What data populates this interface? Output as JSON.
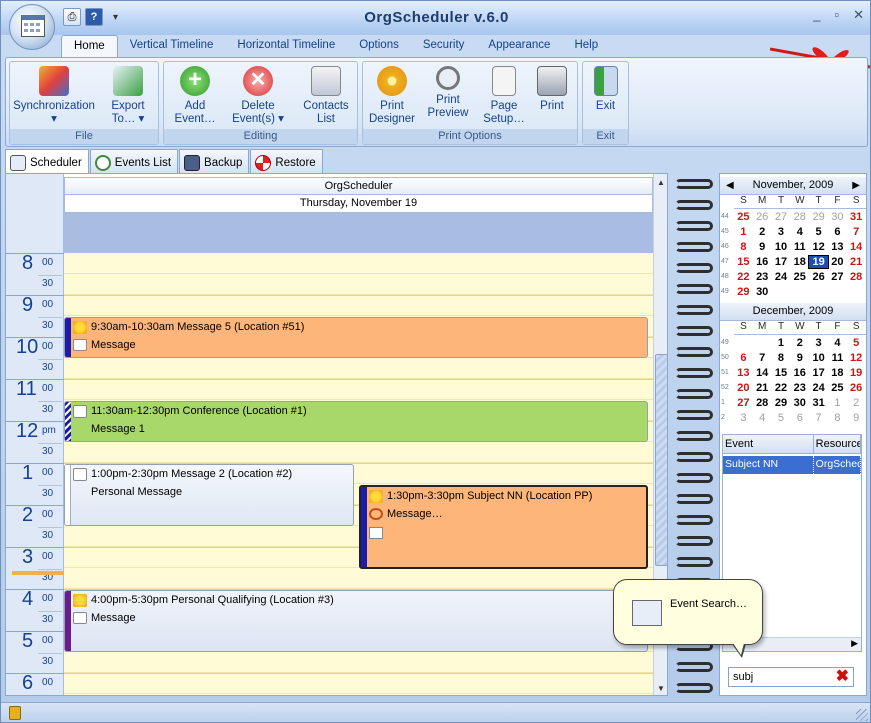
{
  "app": {
    "title": "OrgScheduler v.6.0"
  },
  "window_controls": {
    "minimize": "_",
    "maximize": "▫",
    "close": "✕"
  },
  "qat": {
    "more": "▾"
  },
  "ribbon_tabs": [
    "Home",
    "Vertical Timeline",
    "Horizontal Timeline",
    "Options",
    "Security",
    "Appearance",
    "Help"
  ],
  "ribbon": {
    "file": {
      "label": "File",
      "sync": "Synchronization",
      "sync2": "▾",
      "export": "Export",
      "export2": "To… ▾"
    },
    "editing": {
      "label": "Editing",
      "add": "Add",
      "add2": "Event…",
      "delete": "Delete",
      "delete2": "Event(s) ▾",
      "contacts": "Contacts",
      "contacts2": "List"
    },
    "print": {
      "label": "Print Options",
      "designer": "Print",
      "designer2": "Designer",
      "preview": "Print",
      "preview2": "Preview",
      "setup": "Page",
      "setup2": "Setup…",
      "print": "Print"
    },
    "exit": {
      "label": "Exit",
      "exit": "Exit"
    }
  },
  "view_tabs": [
    "Scheduler",
    "Events List",
    "Backup",
    "Restore"
  ],
  "scheduler": {
    "resource": "OrgScheduler",
    "date": "Thursday, November 19",
    "hours": [
      {
        "h": "8",
        "m": "00"
      },
      {
        "h": "9",
        "m": "00"
      },
      {
        "h": "10",
        "m": "00"
      },
      {
        "h": "11",
        "m": "00"
      },
      {
        "h": "12",
        "m": "pm"
      },
      {
        "h": "1",
        "m": "00"
      },
      {
        "h": "2",
        "m": "00"
      },
      {
        "h": "3",
        "m": "00"
      },
      {
        "h": "4",
        "m": "00"
      },
      {
        "h": "5",
        "m": "00"
      },
      {
        "h": "6",
        "m": "00"
      }
    ],
    "half": "30",
    "events": [
      {
        "title": "9:30am-10:30am Message 5 (Location #51)",
        "body": "Message"
      },
      {
        "title": "11:30am-12:30pm Conference (Location #1)",
        "body": "Message 1"
      },
      {
        "title": "1:00pm-2:30pm Message 2 (Location #2)",
        "body": "Personal Message"
      },
      {
        "title": "1:30pm-3:30pm Subject NN (Location PP)",
        "body": "Message…"
      },
      {
        "title": "4:00pm-5:30pm Personal Qualifying (Location #3)",
        "body": "Message"
      }
    ],
    "colors": {
      "orange": "#fdb57a",
      "green": "#a8d86a",
      "blue": "#e3eaf6",
      "lilac": "#e6eaf5"
    }
  },
  "calendar": {
    "dow": [
      "S",
      "M",
      "T",
      "W",
      "T",
      "F",
      "S"
    ],
    "nov": {
      "title": "November, 2009",
      "weeks": [
        {
          "n": "44",
          "d": [
            "25",
            "26",
            "27",
            "28",
            "29",
            "30",
            "31"
          ]
        },
        {
          "n": "45",
          "d": [
            "1",
            "2",
            "3",
            "4",
            "5",
            "6",
            "7"
          ]
        },
        {
          "n": "46",
          "d": [
            "8",
            "9",
            "10",
            "11",
            "12",
            "13",
            "14"
          ]
        },
        {
          "n": "47",
          "d": [
            "15",
            "16",
            "17",
            "18",
            "19",
            "20",
            "21"
          ]
        },
        {
          "n": "48",
          "d": [
            "22",
            "23",
            "24",
            "25",
            "26",
            "27",
            "28"
          ]
        },
        {
          "n": "49",
          "d": [
            "29",
            "30",
            "",
            "",
            "",
            "",
            ""
          ]
        }
      ]
    },
    "dec": {
      "title": "December, 2009",
      "weeks": [
        {
          "n": "49",
          "d": [
            "",
            "",
            "1",
            "2",
            "3",
            "4",
            "5"
          ]
        },
        {
          "n": "50",
          "d": [
            "6",
            "7",
            "8",
            "9",
            "10",
            "11",
            "12"
          ]
        },
        {
          "n": "51",
          "d": [
            "13",
            "14",
            "15",
            "16",
            "17",
            "18",
            "19"
          ]
        },
        {
          "n": "52",
          "d": [
            "20",
            "21",
            "22",
            "23",
            "24",
            "25",
            "26"
          ]
        },
        {
          "n": "1",
          "d": [
            "27",
            "28",
            "29",
            "30",
            "31",
            "1",
            "2"
          ]
        },
        {
          "n": "2",
          "d": [
            "3",
            "4",
            "5",
            "6",
            "7",
            "8",
            "9"
          ]
        }
      ]
    },
    "prev": "◀",
    "next": "▶"
  },
  "event_list": {
    "cols": [
      "Event",
      "Resource"
    ],
    "rows": [
      [
        "Subject NN",
        "OrgScheduler"
      ]
    ]
  },
  "search": {
    "value": "subj",
    "clear": "✖"
  },
  "tooltip": {
    "text": "Event Search…"
  }
}
